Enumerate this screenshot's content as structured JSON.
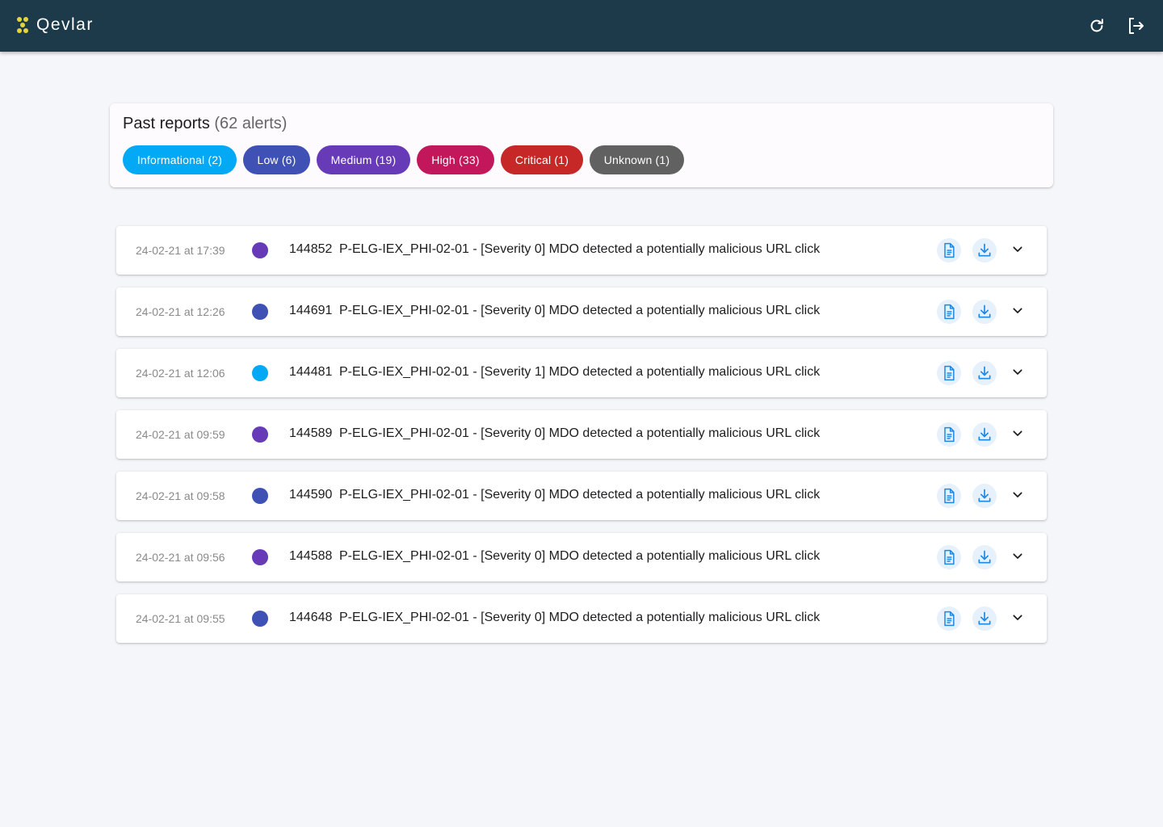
{
  "app": {
    "brand": "Qevlar",
    "logo_color": "#e6d53a",
    "topbar_color": "#1d3a4a",
    "icons": {
      "refresh": "refresh-icon",
      "logout": "logout-icon"
    }
  },
  "summary": {
    "title": "Past reports",
    "count": "(62 alerts)",
    "chips": [
      {
        "label": "Informational (2)",
        "color": "#03a9f4"
      },
      {
        "label": "Low (6)",
        "color": "#3f51b5"
      },
      {
        "label": "Medium (19)",
        "color": "#673ab7"
      },
      {
        "label": "High (33)",
        "color": "#c2185b"
      },
      {
        "label": "Critical (1)",
        "color": "#c62828"
      },
      {
        "label": "Unknown (1)",
        "color": "#616161"
      }
    ]
  },
  "reports": [
    {
      "date": "24-02-21 at 17:39",
      "severity_color": "#673ab7",
      "id": "144852",
      "title": "P-ELG-IEX_PHI-02-01 - [Severity 0] MDO detected a potentially malicious URL click"
    },
    {
      "date": "24-02-21 at 12:26",
      "severity_color": "#3f51b5",
      "id": "144691",
      "title": "P-ELG-IEX_PHI-02-01 - [Severity 0] MDO detected a potentially malicious URL click"
    },
    {
      "date": "24-02-21 at 12:06",
      "severity_color": "#03a9f4",
      "id": "144481",
      "title": "P-ELG-IEX_PHI-02-01 - [Severity 1] MDO detected a potentially malicious URL click"
    },
    {
      "date": "24-02-21 at 09:59",
      "severity_color": "#673ab7",
      "id": "144589",
      "title": "P-ELG-IEX_PHI-02-01 - [Severity 0] MDO detected a potentially malicious URL click"
    },
    {
      "date": "24-02-21 at 09:58",
      "severity_color": "#3f51b5",
      "id": "144590",
      "title": "P-ELG-IEX_PHI-02-01 - [Severity 0] MDO detected a potentially malicious URL click"
    },
    {
      "date": "24-02-21 at 09:56",
      "severity_color": "#673ab7",
      "id": "144588",
      "title": "P-ELG-IEX_PHI-02-01 - [Severity 0] MDO detected a potentially malicious URL click"
    },
    {
      "date": "24-02-21 at 09:55",
      "severity_color": "#3f51b5",
      "id": "144648",
      "title": "P-ELG-IEX_PHI-02-01 - [Severity 0] MDO detected a potentially malicious URL click"
    }
  ],
  "row_icons": {
    "report": "document-icon",
    "download": "download-icon",
    "expand": "chevron-down-icon"
  },
  "accent_color": "#1e88e5"
}
